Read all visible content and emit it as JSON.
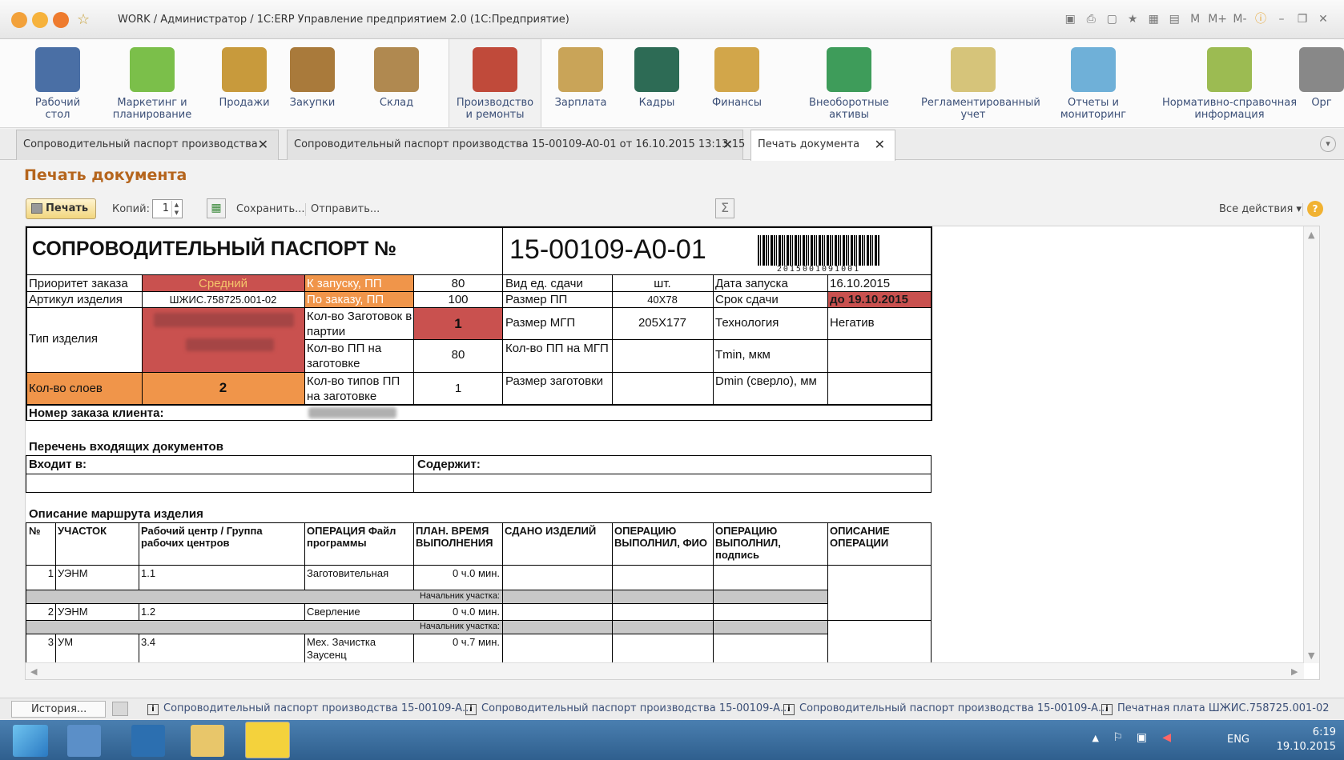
{
  "window": {
    "title": "WORK / Администратор / 1С:ERP Управление предприятием 2.0  (1С:Предприятие)",
    "tools": [
      "M",
      "M+",
      "M-"
    ]
  },
  "sections": [
    {
      "label": "Рабочий\nстол",
      "icon": "desktop-icon",
      "color": "#4a6fa5"
    },
    {
      "label": "Маркетинг и\nпланирование",
      "icon": "pie-chart-icon",
      "color": "#7bbf4a"
    },
    {
      "label": "Продажи",
      "icon": "truck-icon",
      "color": "#c89a3c"
    },
    {
      "label": "Закупки",
      "icon": "boxes-icon",
      "color": "#a97a3b"
    },
    {
      "label": "Склад",
      "icon": "warehouse-shelf-icon",
      "color": "#b08950"
    },
    {
      "label": "Производство\nи ремонты",
      "icon": "factory-icon",
      "color": "#c04a3a"
    },
    {
      "label": "Зарплата",
      "icon": "abacus-icon",
      "color": "#c9a458"
    },
    {
      "label": "Кадры",
      "icon": "passport-icon",
      "color": "#2d6b55"
    },
    {
      "label": "Финансы",
      "icon": "coins-icon",
      "color": "#d2a64a"
    },
    {
      "label": "Внеоборотные\nактивы",
      "icon": "building-icon",
      "color": "#3e9c5a"
    },
    {
      "label": "Регламентированный\nучет",
      "icon": "documents-icon",
      "color": "#d6c47a"
    },
    {
      "label": "Отчеты и\nмониторинг",
      "icon": "bar-chart-icon",
      "color": "#6fb0d8"
    },
    {
      "label": "Нормативно-справочная\nинформация",
      "icon": "binders-icon",
      "color": "#9cbb52"
    },
    {
      "label": "Орг",
      "icon": "org-icon",
      "color": "#888888"
    }
  ],
  "tabs": [
    {
      "label": "Сопроводительный паспорт производства"
    },
    {
      "label": "Сопроводительный паспорт производства 15-00109-А0-01 от 16.10.2015 13:13:15"
    },
    {
      "label": "Печать документа"
    }
  ],
  "page_title": "Печать документа",
  "toolbar": {
    "print": "Печать",
    "copies_label": "Копий:",
    "copies_value": "1",
    "save": "Сохранить...",
    "send": "Отправить...",
    "sum": "Σ",
    "all_actions": "Все действия ▾",
    "help": "?"
  },
  "doc": {
    "heading": "СОПРОВОДИТЕЛЬНЫЙ ПАСПОРТ №",
    "number": "15-00109-А0-01",
    "barcode_digits": "2015001091001",
    "rows": {
      "priority_label": "Приоритет заказа",
      "priority_value": "Средний",
      "launch_pp_label": "К запуску, ПП",
      "launch_pp_value": "80",
      "unit_label": "Вид ед. сдачи",
      "unit_value": "шт.",
      "launch_date_label": "Дата запуска",
      "launch_date_value": "16.10.2015",
      "article_label": "Артикул изделия",
      "article_value": "ШЖИС.758725.001-02",
      "order_pp_label": "По заказу, ПП",
      "order_pp_value": "100",
      "pp_size_label": "Размер ПП",
      "pp_size_value": "40Х78",
      "due_label": "Срок сдачи",
      "due_value": "до 19.10.2015",
      "type_label": "Тип изделия",
      "blanks_label": "Кол-во Заготовок в партии",
      "blanks_value": "1",
      "mgp_size_label": "Размер МГП",
      "mgp_size_value": "205Х177",
      "tech_label": "Технология",
      "tech_value": "Негатив",
      "pp_per_blank_label": "Кол-во ПП на заготовке",
      "pp_per_blank_value": "80",
      "pp_per_mgp_label": "Кол-во ПП на МГП",
      "tmin_label": "Tmin, мкм",
      "layers_label": "Кол-во слоев",
      "layers_value": "2",
      "pp_types_label": "Кол-во типов ПП на заготовке",
      "pp_types_value": "1",
      "blank_size_label": "Размер заготовки",
      "dmin_label": "Dmin (сверло), мм",
      "client_order_label": "Номер заказа клиента:"
    },
    "incoming": {
      "title": "Перечень входящих документов",
      "in_label": "Входит в:",
      "contains_label": "Содержит:"
    },
    "route": {
      "title": "Описание маршрута изделия",
      "headers": [
        "№",
        "УЧАСТОК",
        "Рабочий центр / Группа рабочих центров",
        "ОПЕРАЦИЯ Файл программы",
        "ПЛАН. ВРЕМЯ ВЫПОЛНЕНИЯ",
        "СДАНО ИЗДЕЛИЙ",
        "ОПЕРАЦИЮ ВЫПОЛНИЛ, ФИО",
        "ОПЕРАЦИЮ ВЫПОЛНИЛ, подпись",
        "ОПИСАНИЕ ОПЕРАЦИИ"
      ],
      "rows": [
        {
          "n": "1",
          "area": "УЭНМ",
          "wc": "1.1",
          "op": "Заготовительная",
          "time": "0 ч.0 мин."
        },
        {
          "n": "2",
          "area": "УЭНМ",
          "wc": "1.2",
          "op": "Сверление",
          "time": "0 ч.0 мин."
        },
        {
          "n": "3",
          "area": "УМ",
          "wc": "3.4",
          "op": "Мех. Зачистка Заусенц",
          "time": "0 ч.7 мин."
        }
      ],
      "chief_label": "Начальник участка:"
    },
    "colors": {
      "red": "#c9514f",
      "orange": "#f0954a",
      "gray": "#c8c8c8"
    }
  },
  "history": {
    "button": "История...",
    "items": [
      "Сопроводительный паспорт производства 15-00109-А...",
      "Сопроводительный паспорт производства 15-00109-А...",
      "Сопроводительный паспорт производства 15-00109-А...",
      "Печатная плата ШЖИС.758725.001-02"
    ]
  },
  "taskbar": {
    "lang": "ENG",
    "time": "6:19",
    "date": "19.10.2015"
  }
}
